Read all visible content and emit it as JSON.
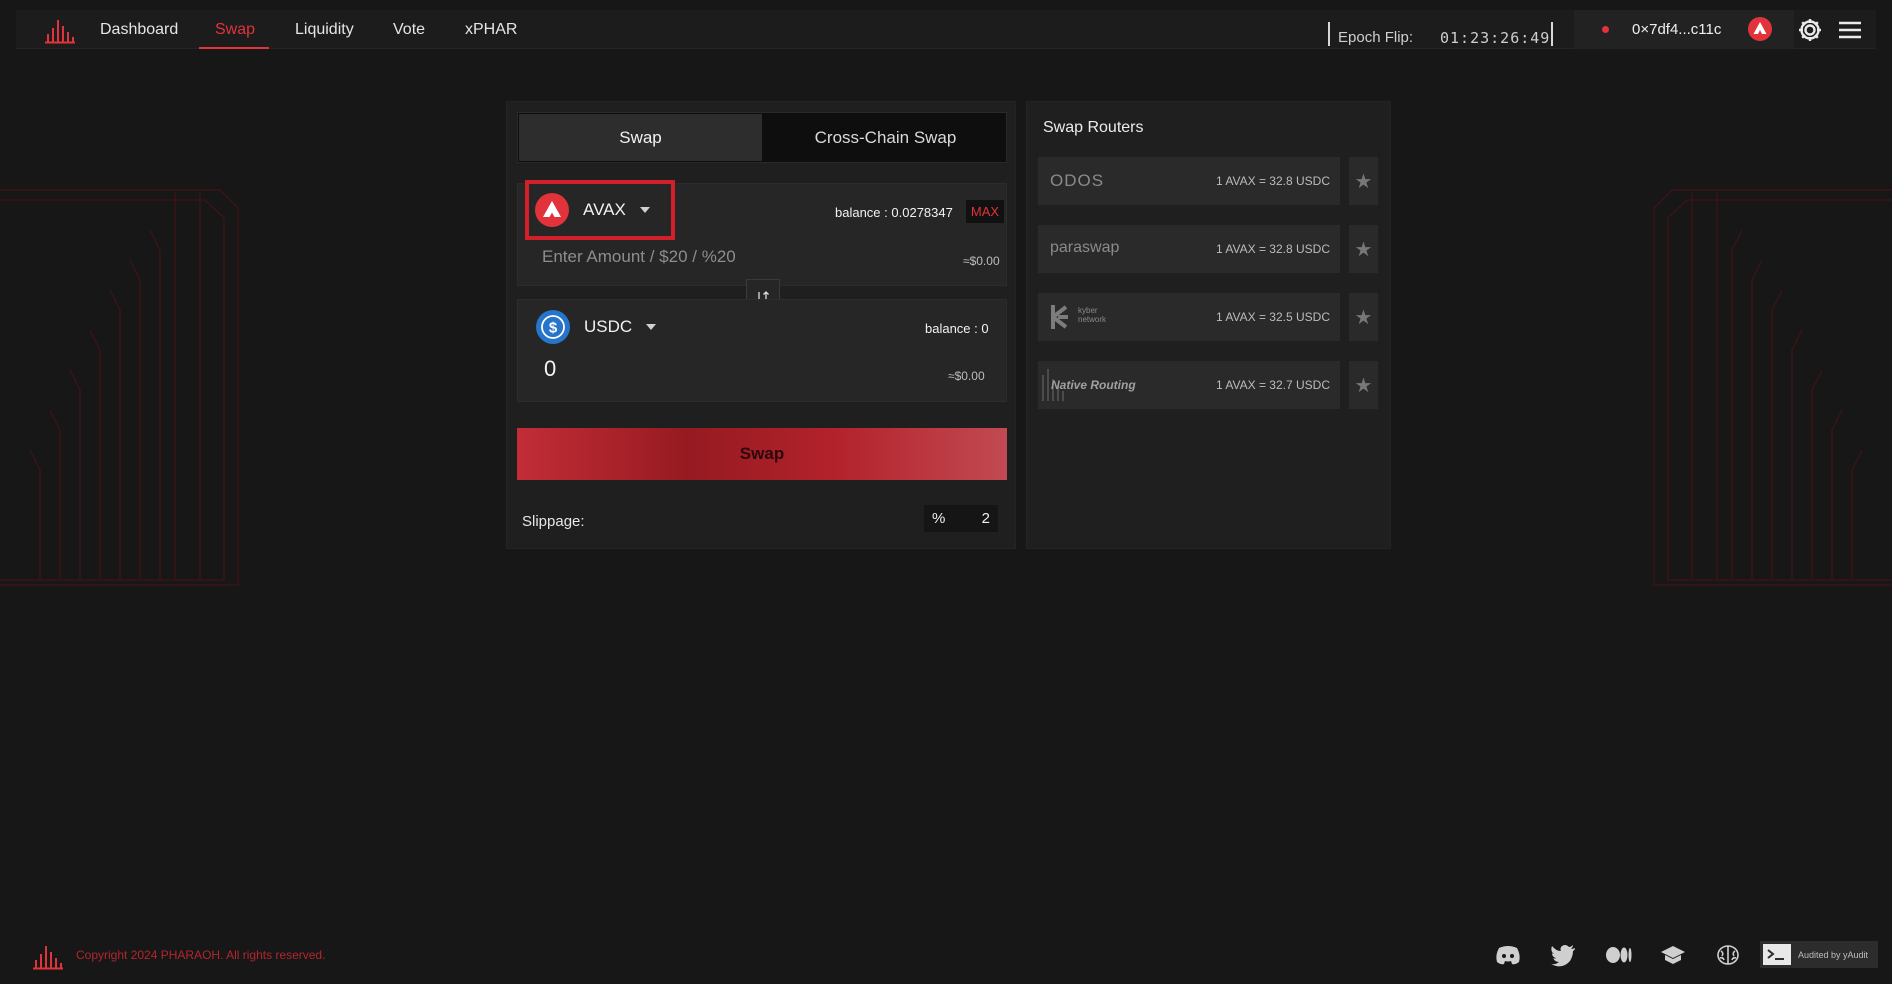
{
  "nav": {
    "links": [
      "Dashboard",
      "Swap",
      "Liquidity",
      "Vote",
      "xPHAR"
    ],
    "active": "Swap",
    "epoch_label": "Epoch Flip:",
    "epoch_time": "01:23:26:49",
    "wallet_address": "0×7df4...c11c"
  },
  "swap": {
    "tabs": [
      "Swap",
      "Cross-Chain Swap"
    ],
    "active_tab": "Swap",
    "from": {
      "token": "AVAX",
      "balance_label": "balance",
      "balance_value": ": 0.0278347",
      "max_label": "MAX",
      "amount_placeholder": "Enter Amount / $20 / %20",
      "usd_value": "≈$0.00"
    },
    "to": {
      "token": "USDC",
      "balance_label": "balance",
      "balance_value": ": 0",
      "amount": "0",
      "usd_value": "≈$0.00"
    },
    "swap_button": "Swap",
    "slippage_label": "Slippage:",
    "slippage_unit": "%",
    "slippage_value": "2"
  },
  "routers": {
    "title": "Swap Routers",
    "items": [
      {
        "name": "ODOS",
        "rate": "1 AVAX = 32.8 USDC"
      },
      {
        "name": "paraswap",
        "rate": "1 AVAX = 32.8 USDC"
      },
      {
        "name": "kyber network",
        "rate": "1 AVAX = 32.5 USDC"
      },
      {
        "name": "Native Routing",
        "rate": "1 AVAX = 32.7 USDC"
      }
    ]
  },
  "footer": {
    "copyright": "Copyright 2024 PHARAOH. All rights reserved.",
    "social_icons": [
      "discord-icon",
      "twitter-icon",
      "medium-icon",
      "docs-icon",
      "brain-icon"
    ],
    "audit_label": "Audited by yAudit"
  },
  "colors": {
    "accent": "#e2333b",
    "background": "#171717",
    "panel": "#1f1f1f"
  }
}
